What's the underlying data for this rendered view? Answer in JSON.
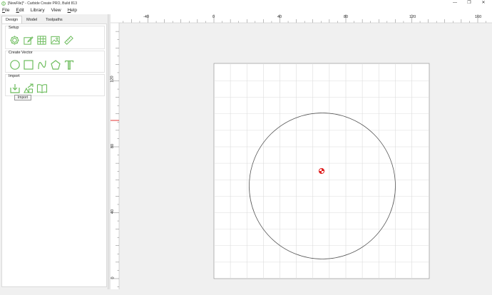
{
  "window": {
    "title": "[NewFile]* - Carbide Create PRO, Build 813",
    "controls": [
      "—",
      "❐",
      "✕"
    ]
  },
  "menu": [
    {
      "label": "File",
      "key": "F",
      "rest": "ile"
    },
    {
      "label": "Edit",
      "key": "E",
      "rest": "dit"
    },
    {
      "label": "Library",
      "key": "",
      "rest": "Library"
    },
    {
      "label": "View",
      "key": "",
      "rest": "View"
    },
    {
      "label": "Help",
      "key": "H",
      "rest": "elp"
    }
  ],
  "tabs": [
    "Design",
    "Model",
    "Toolpaths"
  ],
  "active_tab": "Design",
  "sections": {
    "setup": {
      "title": "Setup",
      "icons": [
        "job-setup-icon",
        "edit-icon",
        "grid-icon",
        "image-icon",
        "ruler-icon"
      ]
    },
    "create_vector": {
      "title": "Create Vector",
      "icons": [
        "circle-icon",
        "rectangle-icon",
        "curve-icon",
        "polygon-icon",
        "text-icon"
      ]
    },
    "import": {
      "title": "Import",
      "icons": [
        "import-icon",
        "import-svg-icon",
        "library-icon"
      ]
    }
  },
  "tooltip": "Import",
  "ruler": {
    "x_ticks": [
      "-40",
      "0",
      "40",
      "80",
      "120",
      "160"
    ],
    "y_ticks": [
      "120",
      "80",
      "40",
      "0"
    ]
  },
  "colors": {
    "icon_green": "#6cbc5c",
    "grid_line": "#dcdcdc",
    "circle_stroke": "#555555",
    "origin_red": "#e02020"
  }
}
